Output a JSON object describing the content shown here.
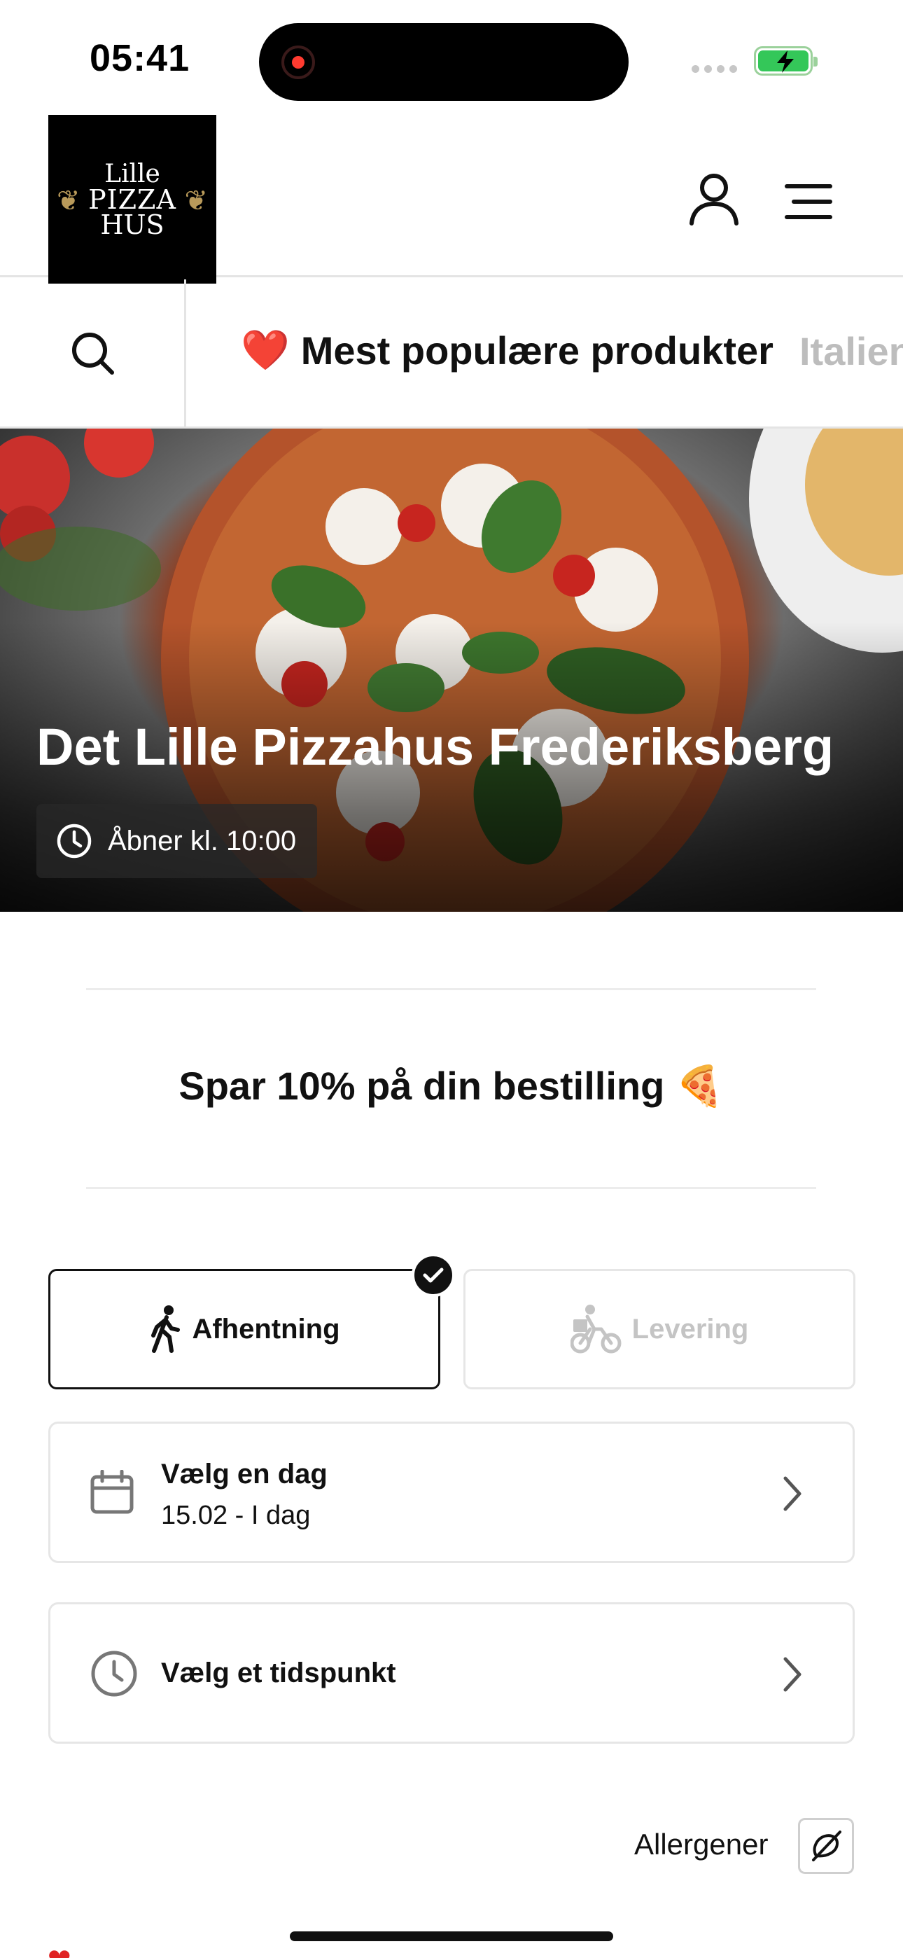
{
  "status_bar": {
    "time": "05:41"
  },
  "header": {
    "logo": {
      "line1": "Lille",
      "line2": "PIZZA",
      "line3": "HUS"
    }
  },
  "categories": {
    "active": {
      "emoji": "❤️",
      "label": "Mest populære produkter"
    },
    "next": {
      "label": "Italien"
    }
  },
  "hero": {
    "restaurant_name": "Det Lille Pizzahus Frederiksberg",
    "opening_text": "Åbner kl. 10:00"
  },
  "promo": {
    "text": "Spar 10% på din bestilling",
    "emoji": "🍕"
  },
  "order_mode": {
    "pickup_label": "Afhentning",
    "delivery_label": "Levering",
    "selected": "pickup"
  },
  "day_picker": {
    "title": "Vælg en dag",
    "value": "15.02 - I dag"
  },
  "time_picker": {
    "title": "Vælg et tidspunkt"
  },
  "allergens": {
    "label": "Allergener"
  },
  "colors": {
    "accent": "#111111",
    "disabled": "#c4c4c4",
    "heart": "#e02424",
    "battery": "#34c759"
  }
}
